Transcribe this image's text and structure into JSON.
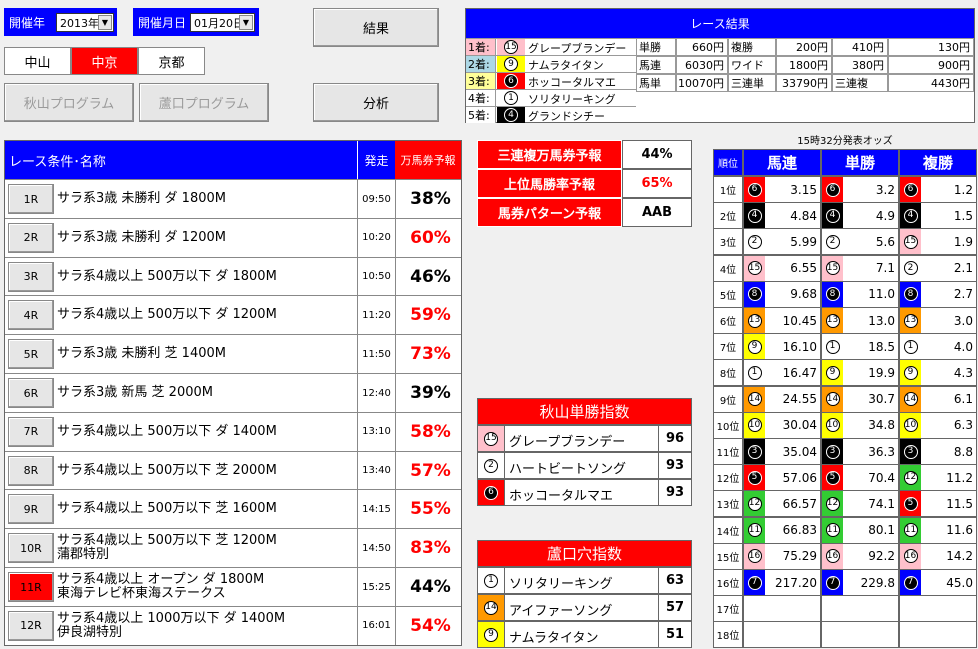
{
  "top": {
    "year_label": "開催年",
    "year_value": "2013年",
    "date_label": "開催月日",
    "date_value": "01月20日",
    "result_button": "結果",
    "analysis_button": "分析",
    "venues": [
      "中山",
      "中京",
      "京都"
    ],
    "selected_venue": 1,
    "akiyama_program": "秋山プログラム",
    "rokaku_program": "蘆口プログラム"
  },
  "race_result": {
    "title": "レース結果",
    "places": [
      {
        "label": "1着:",
        "num": "15",
        "name": "グレープブランデー"
      },
      {
        "label": "2着:",
        "num": "9",
        "name": "ナムラタイタン"
      },
      {
        "label": "3着:",
        "num": "6",
        "name": "ホッコータルマエ"
      },
      {
        "label": "4着:",
        "num": "1",
        "name": "ソリタリーキング"
      },
      {
        "label": "5着:",
        "num": "4",
        "name": "グランドシチー"
      }
    ],
    "payouts_row1": [
      "単勝",
      "660円",
      "複勝",
      "200円",
      "410円",
      "130円"
    ],
    "payouts_row2": [
      "馬連",
      "6030円",
      "ワイド",
      "1800円",
      "380円",
      "900円"
    ],
    "payouts_row3": [
      "馬単",
      "10070円",
      "三連単",
      "33790円",
      "三連複",
      "4430円"
    ]
  },
  "race_list": {
    "header_name": "レース条件･名称",
    "header_time": "発走",
    "header_pct": "万馬券予報",
    "races": [
      {
        "no": "1R",
        "line1": "サラ系3歳 未勝利 ダ 1800M",
        "line2": "",
        "time": "09:50",
        "pct": "38%",
        "hot": false
      },
      {
        "no": "2R",
        "line1": "サラ系3歳 未勝利 ダ 1200M",
        "line2": "",
        "time": "10:20",
        "pct": "60%",
        "hot": true
      },
      {
        "no": "3R",
        "line1": "サラ系4歳以上 500万以下 ダ 1800M",
        "line2": "",
        "time": "10:50",
        "pct": "46%",
        "hot": false
      },
      {
        "no": "4R",
        "line1": "サラ系4歳以上 500万以下 ダ 1200M",
        "line2": "",
        "time": "11:20",
        "pct": "59%",
        "hot": true
      },
      {
        "no": "5R",
        "line1": "サラ系3歳 未勝利 芝 1400M",
        "line2": "",
        "time": "11:50",
        "pct": "73%",
        "hot": true
      },
      {
        "no": "6R",
        "line1": "サラ系3歳 新馬 芝 2000M",
        "line2": "",
        "time": "12:40",
        "pct": "39%",
        "hot": false
      },
      {
        "no": "7R",
        "line1": "サラ系4歳以上 500万以下 ダ 1400M",
        "line2": "",
        "time": "13:10",
        "pct": "58%",
        "hot": true
      },
      {
        "no": "8R",
        "line1": "サラ系4歳以上 500万以下 芝 2000M",
        "line2": "",
        "time": "13:40",
        "pct": "57%",
        "hot": true
      },
      {
        "no": "9R",
        "line1": "サラ系4歳以上 500万以下 芝 1600M",
        "line2": "",
        "time": "14:15",
        "pct": "55%",
        "hot": true
      },
      {
        "no": "10R",
        "line1": "サラ系4歳以上 500万以下 芝 1200M",
        "line2": "蒲郡特別",
        "time": "14:50",
        "pct": "83%",
        "hot": true
      },
      {
        "no": "11R",
        "line1": "サラ系4歳以上 オープン ダ 1800M",
        "line2": "東海テレビ杯東海ステークス",
        "time": "15:25",
        "pct": "44%",
        "hot": false
      },
      {
        "no": "12R",
        "line1": "サラ系4歳以上 1000万以下 ダ 1400M",
        "line2": "伊良湖特別",
        "time": "16:01",
        "pct": "54%",
        "hot": true
      }
    ],
    "selected_index": 10
  },
  "forecast": [
    {
      "label": "三連複万馬券予報",
      "value": "44%",
      "red": false
    },
    {
      "label": "上位馬勝率予報",
      "value": "65%",
      "red": true
    },
    {
      "label": "馬券パターン予報",
      "value": "AAB",
      "red": false
    }
  ],
  "akiyama_index": {
    "title": "秋山単勝指数",
    "rows": [
      {
        "num": "15",
        "name": "グレープブランデー",
        "score": "96"
      },
      {
        "num": "2",
        "name": "ハートビートソング",
        "score": "93"
      },
      {
        "num": "6",
        "name": "ホッコータルマエ",
        "score": "93"
      }
    ]
  },
  "rokaku_index": {
    "title": "蘆口穴指数",
    "rows": [
      {
        "num": "1",
        "name": "ソリタリーキング",
        "score": "63"
      },
      {
        "num": "14",
        "name": "アイファーソング",
        "score": "57"
      },
      {
        "num": "9",
        "name": "ナムラタイタン",
        "score": "51"
      }
    ]
  },
  "odds": {
    "caption": "15時32分発表オッズ",
    "col_rank": "順位",
    "col_umaren": "馬連",
    "col_tansho": "単勝",
    "col_fukusho": "複勝",
    "rows": [
      {
        "rank": "1位",
        "u": [
          "6",
          "3.15"
        ],
        "t": [
          "6",
          "3.2"
        ],
        "f": [
          "6",
          "1.2"
        ]
      },
      {
        "rank": "2位",
        "u": [
          "4",
          "4.84"
        ],
        "t": [
          "4",
          "4.9"
        ],
        "f": [
          "4",
          "1.5"
        ]
      },
      {
        "rank": "3位",
        "u": [
          "2",
          "5.99"
        ],
        "t": [
          "2",
          "5.6"
        ],
        "f": [
          "15",
          "1.9"
        ]
      },
      {
        "rank": "4位",
        "u": [
          "15",
          "6.55"
        ],
        "t": [
          "15",
          "7.1"
        ],
        "f": [
          "2",
          "2.1"
        ]
      },
      {
        "rank": "5位",
        "u": [
          "8",
          "9.68"
        ],
        "t": [
          "8",
          "11.0"
        ],
        "f": [
          "8",
          "2.7"
        ]
      },
      {
        "rank": "6位",
        "u": [
          "13",
          "10.45"
        ],
        "t": [
          "13",
          "13.0"
        ],
        "f": [
          "13",
          "3.0"
        ]
      },
      {
        "rank": "7位",
        "u": [
          "9",
          "16.10"
        ],
        "t": [
          "1",
          "18.5"
        ],
        "f": [
          "1",
          "4.0"
        ]
      },
      {
        "rank": "8位",
        "u": [
          "1",
          "16.47"
        ],
        "t": [
          "9",
          "19.9"
        ],
        "f": [
          "9",
          "4.3"
        ]
      },
      {
        "rank": "9位",
        "u": [
          "14",
          "24.55"
        ],
        "t": [
          "14",
          "30.7"
        ],
        "f": [
          "14",
          "6.1"
        ]
      },
      {
        "rank": "10位",
        "u": [
          "10",
          "30.04"
        ],
        "t": [
          "10",
          "34.8"
        ],
        "f": [
          "10",
          "6.3"
        ]
      },
      {
        "rank": "11位",
        "u": [
          "3",
          "35.04"
        ],
        "t": [
          "3",
          "36.3"
        ],
        "f": [
          "3",
          "8.8"
        ]
      },
      {
        "rank": "12位",
        "u": [
          "5",
          "57.06"
        ],
        "t": [
          "5",
          "70.4"
        ],
        "f": [
          "12",
          "11.2"
        ]
      },
      {
        "rank": "13位",
        "u": [
          "12",
          "66.57"
        ],
        "t": [
          "12",
          "74.1"
        ],
        "f": [
          "5",
          "11.5"
        ]
      },
      {
        "rank": "14位",
        "u": [
          "11",
          "66.83"
        ],
        "t": [
          "11",
          "80.1"
        ],
        "f": [
          "11",
          "11.6"
        ]
      },
      {
        "rank": "15位",
        "u": [
          "16",
          "75.29"
        ],
        "t": [
          "16",
          "92.2"
        ],
        "f": [
          "16",
          "14.2"
        ]
      },
      {
        "rank": "16位",
        "u": [
          "7",
          "217.20"
        ],
        "t": [
          "7",
          "229.8"
        ],
        "f": [
          "7",
          "45.0"
        ]
      },
      {
        "rank": "17位",
        "u": [
          "",
          ""
        ],
        "t": [
          "",
          ""
        ],
        "f": [
          "",
          ""
        ]
      },
      {
        "rank": "18位",
        "u": [
          "",
          ""
        ],
        "t": [
          "",
          ""
        ],
        "f": [
          "",
          ""
        ]
      }
    ]
  },
  "frame_colors": {
    "1": "#ffffff",
    "2": "#ffffff",
    "3": "#000000",
    "4": "#000000",
    "5": "#ff0000",
    "6": "#ff0000",
    "7": "#0000ff",
    "8": "#0000ff",
    "9": "#ffff00",
    "10": "#ffff00",
    "11": "#33cc33",
    "12": "#33cc33",
    "13": "#ff9900",
    "14": "#ff9900",
    "15": "#ffc0cb",
    "16": "#ffc0cb"
  },
  "place_label_colors": [
    "#ffc0cb",
    "#add8e6",
    "#ffff99",
    "#ffffff",
    "#ffffff"
  ]
}
